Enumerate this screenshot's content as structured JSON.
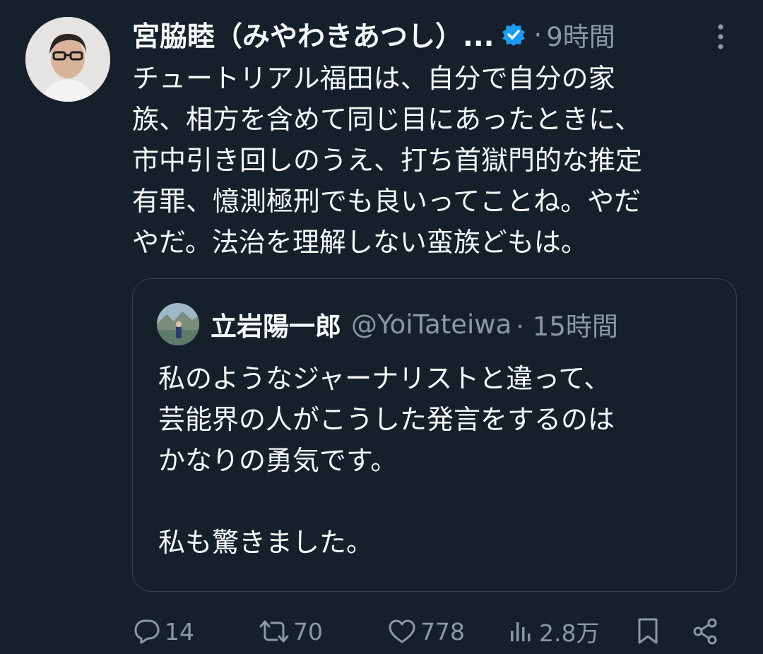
{
  "tweet": {
    "author_name": "宮脇睦（みやわきあつし）...",
    "separator": "·",
    "time": "9時間",
    "text_lines": [
      "チュートリアル福田は、自分で自分の家",
      "族、相方を含めて同じ目にあったときに、",
      "市中引き回しのうえ、打ち首獄門的な推定",
      "有罪、憶測極刑でも良いってことね。やだ",
      "やだ。法治を理解しない蛮族どもは。"
    ]
  },
  "quote": {
    "name": "立岩陽一郎",
    "handle": "@YoiTateiwa",
    "time": "· 15時間",
    "text_lines": [
      "私のようなジャーナリストと違って、",
      "芸能界の人がこうした発言をするのは",
      "かなりの勇気です。",
      "",
      "私も驚きました。"
    ]
  },
  "actions": {
    "replies": "14",
    "retweets": "70",
    "likes": "778",
    "views": "2.8万"
  },
  "colors": {
    "background": "#15202b",
    "text": "#f7f9f9",
    "secondary": "#8b98a5",
    "verified": "#1d9bf0",
    "border": "#38444d"
  }
}
